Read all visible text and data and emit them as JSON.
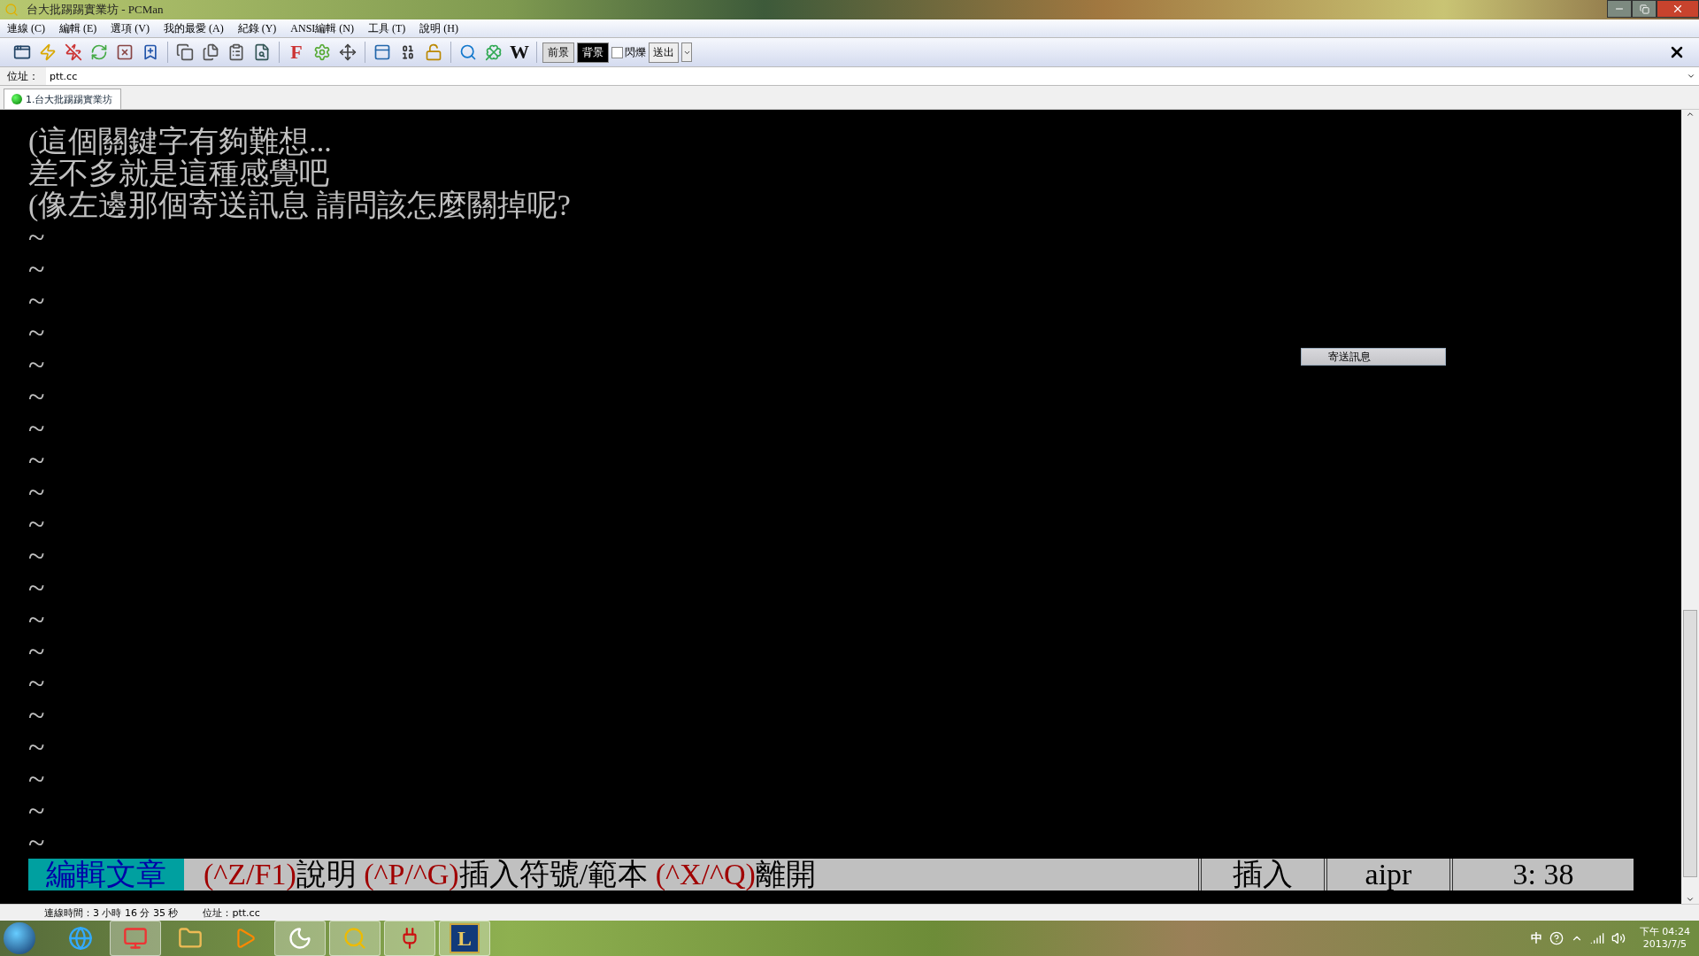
{
  "window": {
    "title": "台大批踢踢實業坊 - PCMan"
  },
  "menu": [
    "連線 (C)",
    "編輯 (E)",
    "選項 (V)",
    "我的最愛 (A)",
    "紀錄 (Y)",
    "ANSI編輯 (N)",
    "工具 (T)",
    "說明 (H)"
  ],
  "toolbar": {
    "glyph_buttons": [
      "F",
      "W"
    ],
    "color_buttons": [
      {
        "label": "前景",
        "selected": false
      },
      {
        "label": "背景",
        "selected": true
      }
    ],
    "blink": {
      "label": "閃爍",
      "checked": false
    },
    "send": "送出"
  },
  "address": {
    "label": "位址：",
    "value": "ptt.cc"
  },
  "tabs": [
    {
      "label": "1.台大批踢踢實業坊",
      "selected": true
    }
  ],
  "terminal": {
    "lines": [
      "(這個關鍵字有夠難想...",
      "差不多就是這種感覺吧",
      "(像左邊那個寄送訊息 請問該怎麼關掉呢?",
      "~",
      "~",
      "~",
      "~",
      "~",
      "~",
      "~",
      "~",
      "~",
      "~",
      "~",
      "~",
      "~",
      "~",
      "~",
      "~",
      "~",
      "~",
      "~",
      "~"
    ],
    "status_segments": [
      {
        "kind": "mode",
        "text": "編輯文章"
      },
      {
        "kind": "key",
        "text": "(^Z/F1)"
      },
      {
        "kind": "label",
        "text": "說明 "
      },
      {
        "kind": "key",
        "text": "(^P/^G)"
      },
      {
        "kind": "label",
        "text": "插入符號/範本 "
      },
      {
        "kind": "key",
        "text": "(^X/^Q)"
      },
      {
        "kind": "label",
        "text": "離開"
      },
      {
        "kind": "field",
        "text": "插入"
      },
      {
        "kind": "field",
        "text": "aipr"
      },
      {
        "kind": "field",
        "text": "3: 38"
      }
    ]
  },
  "popup_menu": [
    "寄送訊息"
  ],
  "status_bar": [
    "連線時間：3 小時 16 分 35 秒",
    "位址：ptt.cc"
  ],
  "taskbar": {
    "app_glyph": "L",
    "ime": "中",
    "clock": {
      "time": "下午 04:24",
      "date": "2013/7/5"
    }
  }
}
